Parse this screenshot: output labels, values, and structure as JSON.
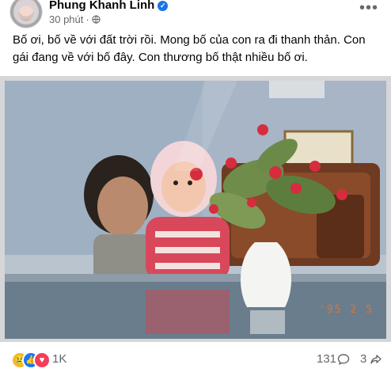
{
  "post": {
    "author_name": "Phung Khanh Linh",
    "timestamp": "30 phút",
    "separator": "·",
    "caption": "Bố ơi, bố về với đất trời rồi. Mong bố của con ra đi thanh thản. Con gái đang về với bố đây. Con thương bố thật nhiều bố ơi.",
    "photo_date_stamp": "'95  2  5"
  },
  "reactions": {
    "icons": [
      "sad-reaction-icon",
      "like-reaction-icon",
      "love-reaction-icon"
    ],
    "count": "1K"
  },
  "comments": {
    "count": "131"
  },
  "shares": {
    "count": "3"
  },
  "colors": {
    "verified_badge": "#1b74e4",
    "secondary_text": "#65676b",
    "like_blue": "#1877f2",
    "love_red": "#f33e58",
    "sad_yellow": "#f7b928",
    "date_stamp_orange": "#e8732e"
  }
}
